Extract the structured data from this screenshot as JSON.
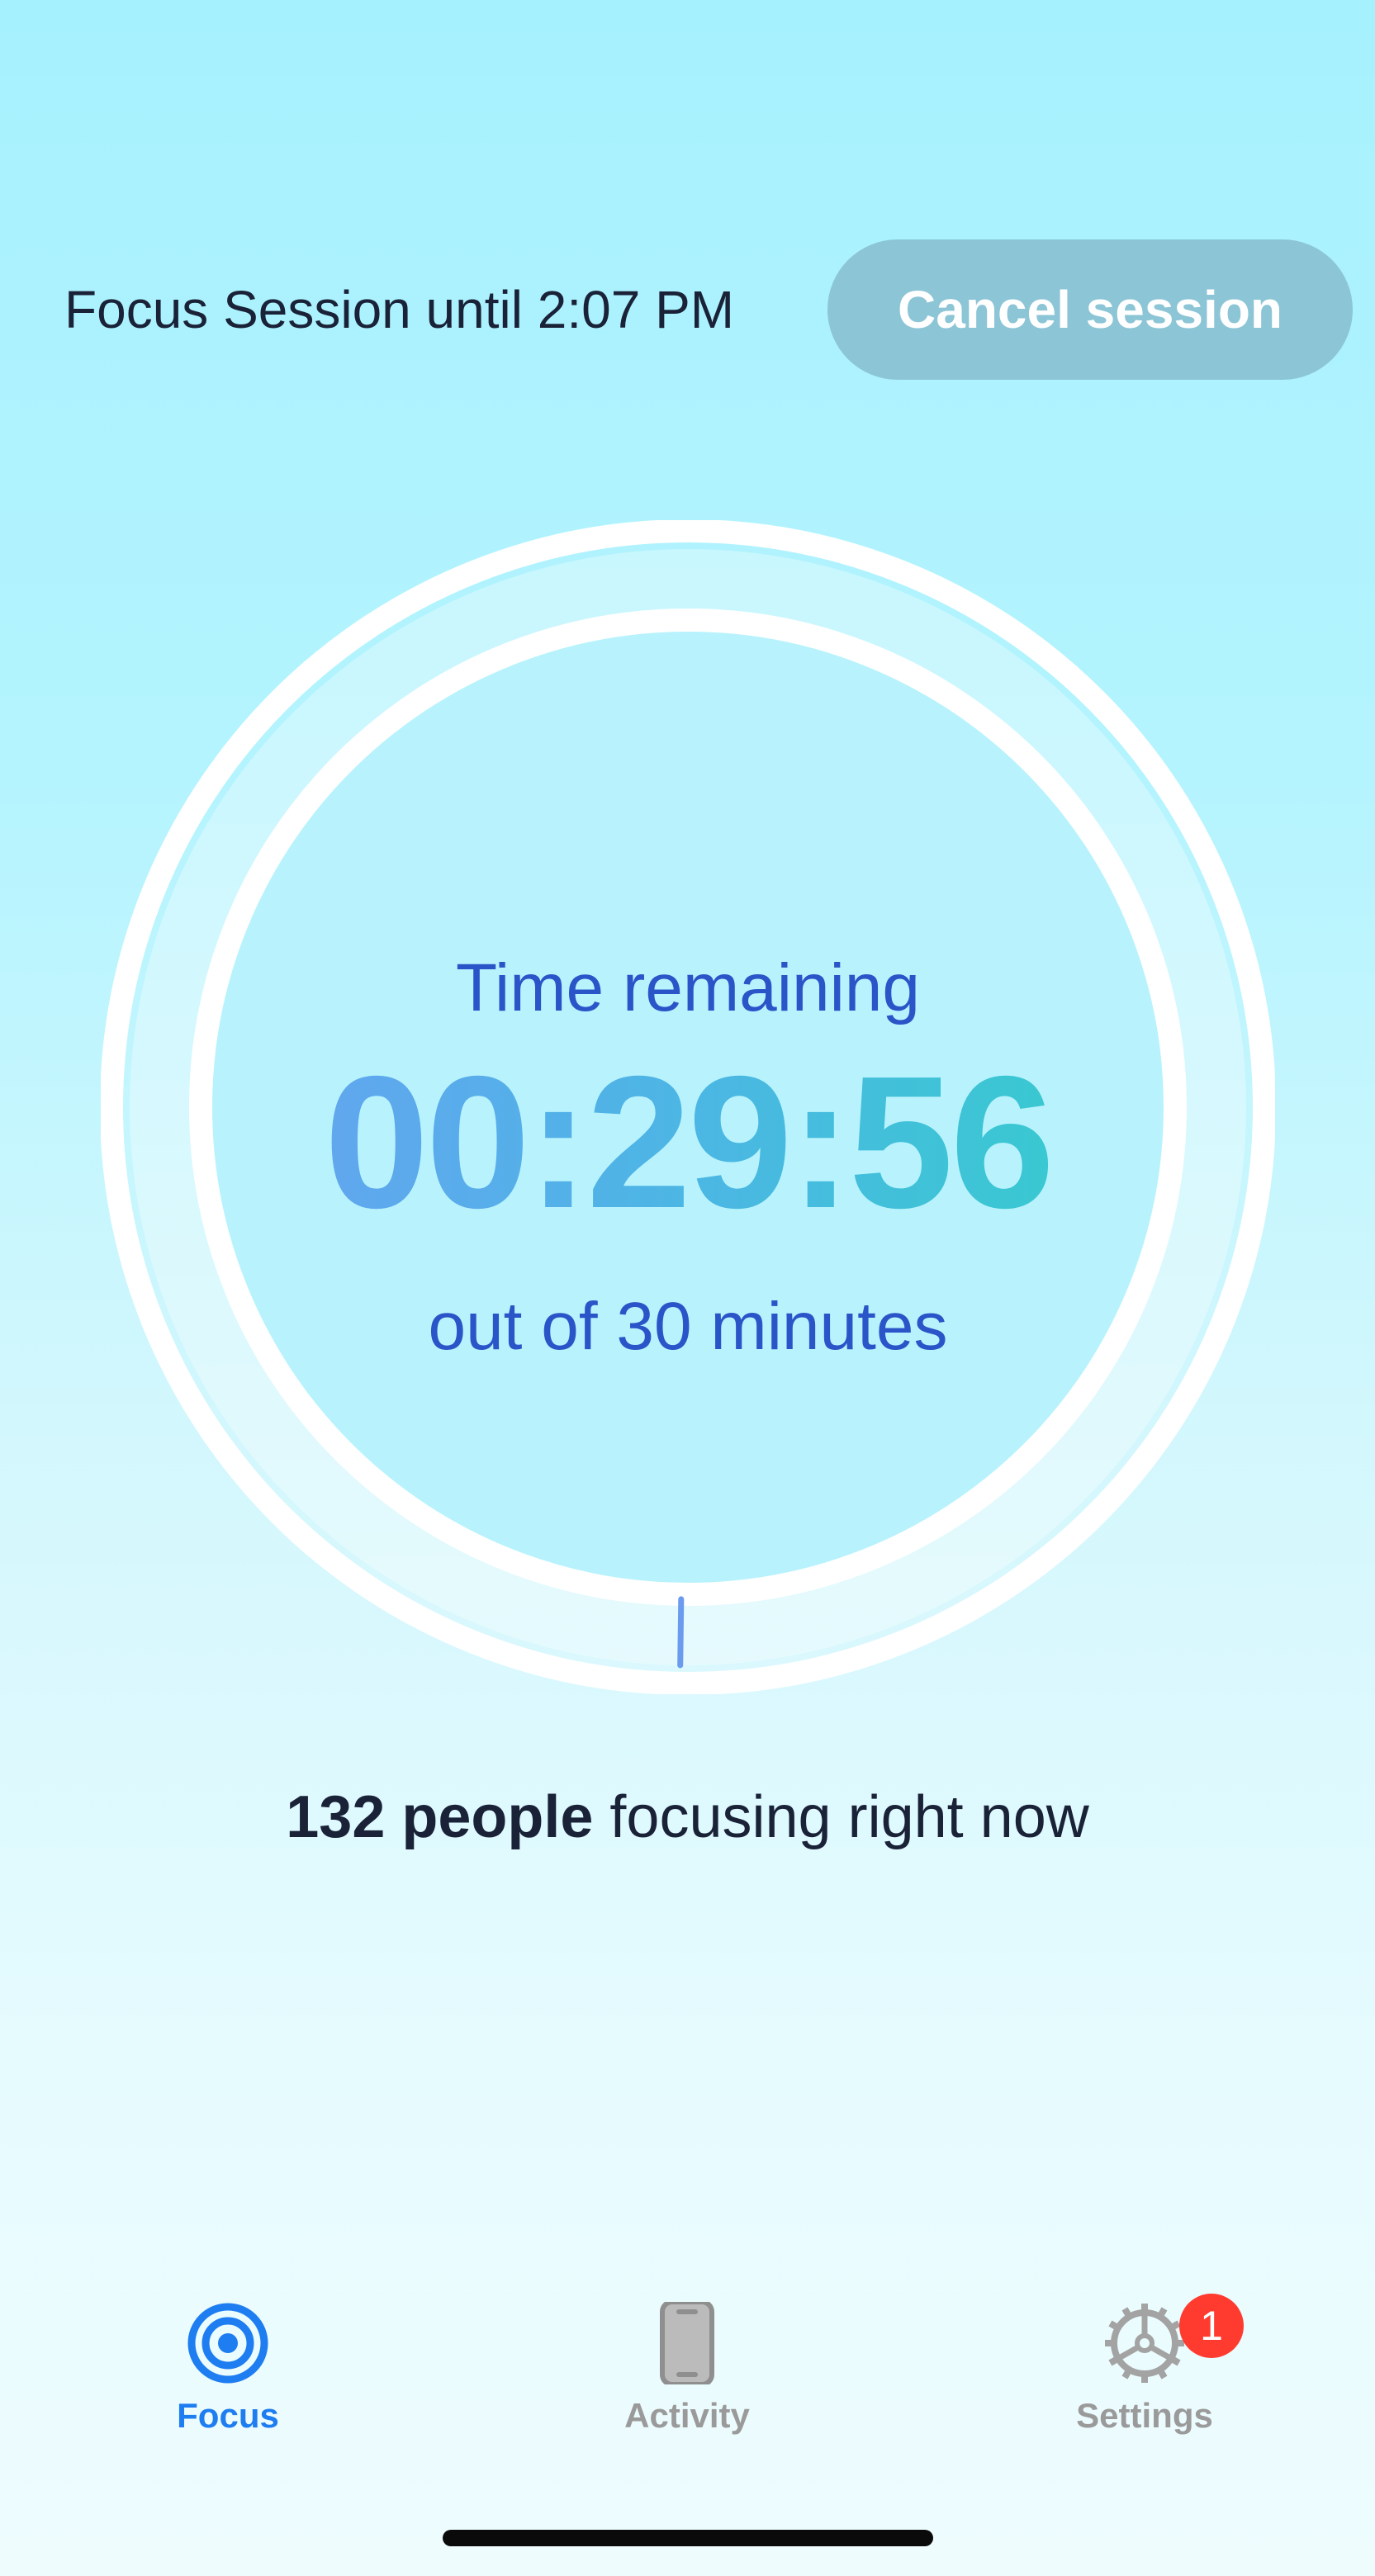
{
  "header": {
    "session_text": "Focus Session until 2:07 PM",
    "cancel_label": "Cancel session"
  },
  "timer": {
    "label": "Time remaining",
    "value": "00:29:56",
    "subtitle": "out of 30 minutes",
    "progress_fraction": 0.0022
  },
  "community": {
    "count": "132 people",
    "suffix": " focusing right now"
  },
  "tabbar": {
    "tabs": [
      {
        "label": "Focus",
        "icon": "focus-target-icon",
        "active": true
      },
      {
        "label": "Activity",
        "icon": "phone-icon",
        "active": false
      },
      {
        "label": "Settings",
        "icon": "gear-icon",
        "active": false
      }
    ],
    "settings_badge": "1"
  },
  "colors": {
    "accent": "#1e7df0",
    "inactive": "#9a9a9a",
    "badge": "#ff3b30",
    "cancel_button": "#8cc5d6",
    "timer_text": "#2a55c8"
  }
}
